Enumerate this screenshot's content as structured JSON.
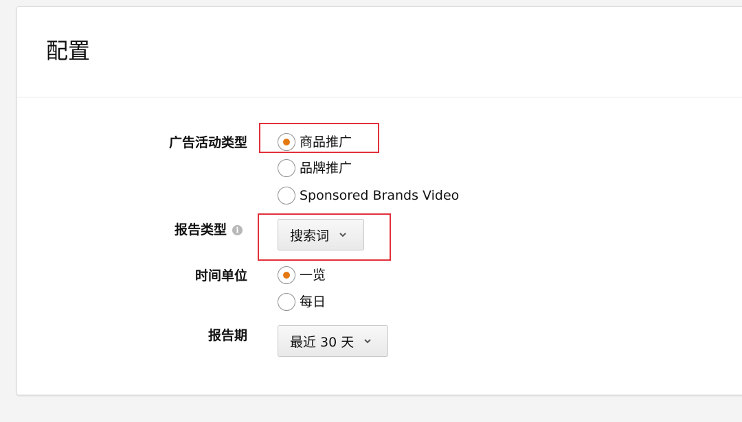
{
  "panel": {
    "title": "配置"
  },
  "campaign_type": {
    "label": "广告活动类型",
    "options": [
      {
        "label": "商品推广",
        "checked": true
      },
      {
        "label": "品牌推广",
        "checked": false
      },
      {
        "label": "Sponsored Brands Video",
        "checked": false
      }
    ]
  },
  "report_type": {
    "label": "报告类型",
    "info_icon": "info-icon",
    "selected": "搜索词"
  },
  "time_unit": {
    "label": "时间单位",
    "options": [
      {
        "label": "一览",
        "checked": true
      },
      {
        "label": "每日",
        "checked": false
      }
    ]
  },
  "report_period": {
    "label": "报告期",
    "selected": "最近 30 天"
  },
  "colors": {
    "accent": "#e47911",
    "highlight_box": "#e2303a"
  }
}
